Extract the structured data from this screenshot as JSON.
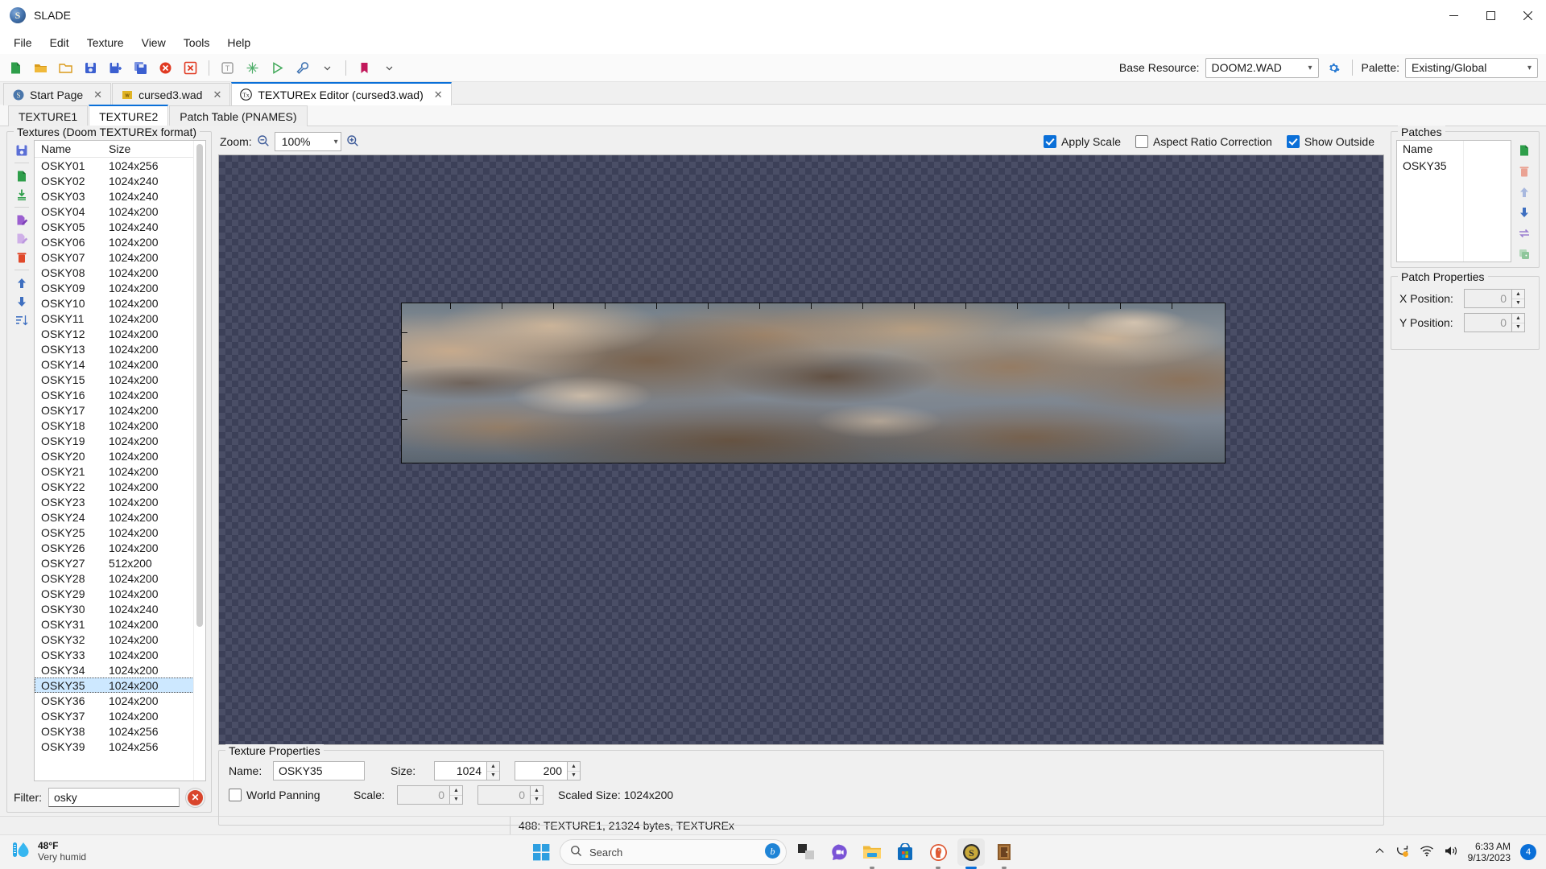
{
  "window": {
    "title": "SLADE",
    "icon": "slade-logo-icon",
    "minimize": "─",
    "maximize": "❐",
    "close": "✕"
  },
  "menubar": {
    "items": [
      "File",
      "Edit",
      "Texture",
      "View",
      "Tools",
      "Help"
    ]
  },
  "toolbar": {
    "buttons": [
      {
        "name": "new-icon",
        "glyph": "doc-green"
      },
      {
        "name": "open-icon",
        "glyph": "folder-open"
      },
      {
        "name": "open-folder-icon",
        "glyph": "folder-outline"
      },
      {
        "name": "save-icon",
        "glyph": "save-blue"
      },
      {
        "name": "save-as-icon",
        "glyph": "save-as"
      },
      {
        "name": "save-all-icon",
        "glyph": "save-all"
      },
      {
        "name": "close-archive-icon",
        "glyph": "close-red"
      },
      {
        "name": "close-all-icon",
        "glyph": "close-all-red"
      },
      {
        "name": "maps-icon",
        "glyph": "tx-grey"
      },
      {
        "name": "map-editor-icon",
        "glyph": "grid-green"
      },
      {
        "name": "run-icon",
        "glyph": "play-green"
      },
      {
        "name": "preferences-icon",
        "glyph": "wrench-blue"
      },
      {
        "name": "preferences-dropdown-icon",
        "glyph": "chevron-down"
      },
      {
        "name": "bookmarks-icon",
        "glyph": "bookmark-red"
      },
      {
        "name": "bookmarks-dropdown-icon",
        "glyph": "chevron-down"
      }
    ],
    "base_resource_label": "Base Resource:",
    "base_resource_value": "DOOM2.WAD",
    "base_resource_settings_icon": "gear-icon",
    "palette_label": "Palette:",
    "palette_value": "Existing/Global"
  },
  "doc_tabs": [
    {
      "label": "Start Page",
      "icon": "slade-logo-icon",
      "active": false,
      "close": "✕"
    },
    {
      "label": "cursed3.wad",
      "icon": "wad-archive-icon",
      "active": false,
      "close": "✕"
    },
    {
      "label": "TEXTUREx Editor (cursed3.wad)",
      "icon": "tx-icon",
      "active": true,
      "close": "✕"
    }
  ],
  "texture_tabs": [
    {
      "label": "TEXTURE1",
      "active": false
    },
    {
      "label": "TEXTURE2",
      "active": true
    },
    {
      "label": "Patch Table (PNAMES)",
      "active": false
    }
  ],
  "textures_panel": {
    "title": "Textures (Doom TEXTUREx format)",
    "tools": [
      {
        "name": "save-list-icon",
        "glyph": "save-blue"
      },
      {
        "name": "new-texture-icon",
        "glyph": "doc-green"
      },
      {
        "name": "import-texture-icon",
        "glyph": "import-green"
      },
      {
        "name": "edit-texture-icon",
        "glyph": "edit-purple"
      },
      {
        "name": "copy-texture-icon",
        "glyph": "edit-purple-faded"
      },
      {
        "name": "delete-texture-icon",
        "glyph": "trash-red"
      },
      {
        "name": "move-up-icon",
        "glyph": "arrow-up-blue"
      },
      {
        "name": "move-down-icon",
        "glyph": "arrow-down-blue"
      },
      {
        "name": "sort-icon",
        "glyph": "sort-blue"
      }
    ],
    "columns": [
      "Name",
      "Size"
    ],
    "rows": [
      {
        "name": "OSKY01",
        "size": "1024x256"
      },
      {
        "name": "OSKY02",
        "size": "1024x240"
      },
      {
        "name": "OSKY03",
        "size": "1024x240"
      },
      {
        "name": "OSKY04",
        "size": "1024x200"
      },
      {
        "name": "OSKY05",
        "size": "1024x240"
      },
      {
        "name": "OSKY06",
        "size": "1024x200"
      },
      {
        "name": "OSKY07",
        "size": "1024x200"
      },
      {
        "name": "OSKY08",
        "size": "1024x200"
      },
      {
        "name": "OSKY09",
        "size": "1024x200"
      },
      {
        "name": "OSKY10",
        "size": "1024x200"
      },
      {
        "name": "OSKY11",
        "size": "1024x200"
      },
      {
        "name": "OSKY12",
        "size": "1024x200"
      },
      {
        "name": "OSKY13",
        "size": "1024x200"
      },
      {
        "name": "OSKY14",
        "size": "1024x200"
      },
      {
        "name": "OSKY15",
        "size": "1024x200"
      },
      {
        "name": "OSKY16",
        "size": "1024x200"
      },
      {
        "name": "OSKY17",
        "size": "1024x200"
      },
      {
        "name": "OSKY18",
        "size": "1024x200"
      },
      {
        "name": "OSKY19",
        "size": "1024x200"
      },
      {
        "name": "OSKY20",
        "size": "1024x200"
      },
      {
        "name": "OSKY21",
        "size": "1024x200"
      },
      {
        "name": "OSKY22",
        "size": "1024x200"
      },
      {
        "name": "OSKY23",
        "size": "1024x200"
      },
      {
        "name": "OSKY24",
        "size": "1024x200"
      },
      {
        "name": "OSKY25",
        "size": "1024x200"
      },
      {
        "name": "OSKY26",
        "size": "1024x200"
      },
      {
        "name": "OSKY27",
        "size": "512x200"
      },
      {
        "name": "OSKY28",
        "size": "1024x200"
      },
      {
        "name": "OSKY29",
        "size": "1024x200"
      },
      {
        "name": "OSKY30",
        "size": "1024x240"
      },
      {
        "name": "OSKY31",
        "size": "1024x200"
      },
      {
        "name": "OSKY32",
        "size": "1024x200"
      },
      {
        "name": "OSKY33",
        "size": "1024x200"
      },
      {
        "name": "OSKY34",
        "size": "1024x200"
      },
      {
        "name": "OSKY35",
        "size": "1024x200",
        "selected": true
      },
      {
        "name": "OSKY36",
        "size": "1024x200"
      },
      {
        "name": "OSKY37",
        "size": "1024x200"
      },
      {
        "name": "OSKY38",
        "size": "1024x256"
      },
      {
        "name": "OSKY39",
        "size": "1024x256"
      }
    ],
    "filter_label": "Filter:",
    "filter_value": "osky",
    "filter_placeholder": "",
    "filter_clear_icon": "clear-filter-icon"
  },
  "viewer": {
    "zoom_label": "Zoom:",
    "zoom_out_icon": "zoom-out-icon",
    "zoom_in_icon": "zoom-in-icon",
    "zoom_value": "100%",
    "checkboxes": [
      {
        "label": "Apply Scale",
        "checked": true
      },
      {
        "label": "Aspect Ratio Correction",
        "checked": false
      },
      {
        "label": "Show Outside",
        "checked": true
      }
    ]
  },
  "texture_properties": {
    "title": "Texture Properties",
    "name_label": "Name:",
    "name_value": "OSKY35",
    "size_label": "Size:",
    "size_width": "1024",
    "size_height": "200",
    "world_panning_label": "World Panning",
    "world_panning_checked": false,
    "scale_label": "Scale:",
    "scale_x": "0",
    "scale_y": "0",
    "scaled_size_text": "Scaled Size: 1024x200"
  },
  "patches_panel": {
    "title": "Patches",
    "columns": [
      "Name"
    ],
    "rows": [
      {
        "name": "OSKY35"
      }
    ],
    "tools": [
      {
        "name": "add-patch-icon",
        "glyph": "doc-green"
      },
      {
        "name": "remove-patch-icon",
        "glyph": "trash-red-faded"
      },
      {
        "name": "patch-up-icon",
        "glyph": "arrow-up-blue-faded"
      },
      {
        "name": "patch-down-icon",
        "glyph": "arrow-down-blue"
      },
      {
        "name": "replace-patch-icon",
        "glyph": "swap-purple"
      },
      {
        "name": "duplicate-patch-icon",
        "glyph": "duplicate-green-faded"
      }
    ]
  },
  "patch_properties": {
    "title": "Patch Properties",
    "x_label": "X Position:",
    "x_value": "0",
    "y_label": "Y Position:",
    "y_value": "0"
  },
  "statusbar": {
    "text": "488: TEXTURE1, 21324 bytes, TEXTUREx"
  },
  "taskbar": {
    "weather_temp": "48°F",
    "weather_desc": "Very humid",
    "weather_icon": "humidity-icon",
    "start_icon": "windows-start-icon",
    "search_placeholder": "Search",
    "search_icon": "search-icon",
    "search_copilot_icon": "bing-copilot-icon",
    "apps": [
      {
        "name": "taskview-icon",
        "active": false,
        "running": false
      },
      {
        "name": "teams-chat-icon",
        "active": false,
        "running": false
      },
      {
        "name": "file-explorer-icon",
        "active": false,
        "running": true
      },
      {
        "name": "microsoft-store-icon",
        "active": false,
        "running": false
      },
      {
        "name": "duckduckgo-browser-icon",
        "active": false,
        "running": true
      },
      {
        "name": "slade-icon",
        "active": true,
        "running": true
      },
      {
        "name": "doom-builder-icon",
        "active": false,
        "running": true
      }
    ],
    "tray_chevron_icon": "chevron-up-icon",
    "tray_update_icon": "windows-update-icon",
    "tray_wifi_icon": "wifi-icon",
    "tray_volume_icon": "volume-icon",
    "clock_time": "6:33 AM",
    "clock_date": "9/13/2023",
    "notification_count": "4"
  },
  "colors": {
    "accent": "#0a6fd8",
    "selection": "#cde8ff",
    "checker_dark": "#3c4058",
    "checker_light": "#4a4e66",
    "sky_blue": "#7d8a96",
    "cloud_light": "#c9ab8c",
    "cloud_mid": "#9b7e61",
    "cloud_dark": "#5e4a3a"
  }
}
